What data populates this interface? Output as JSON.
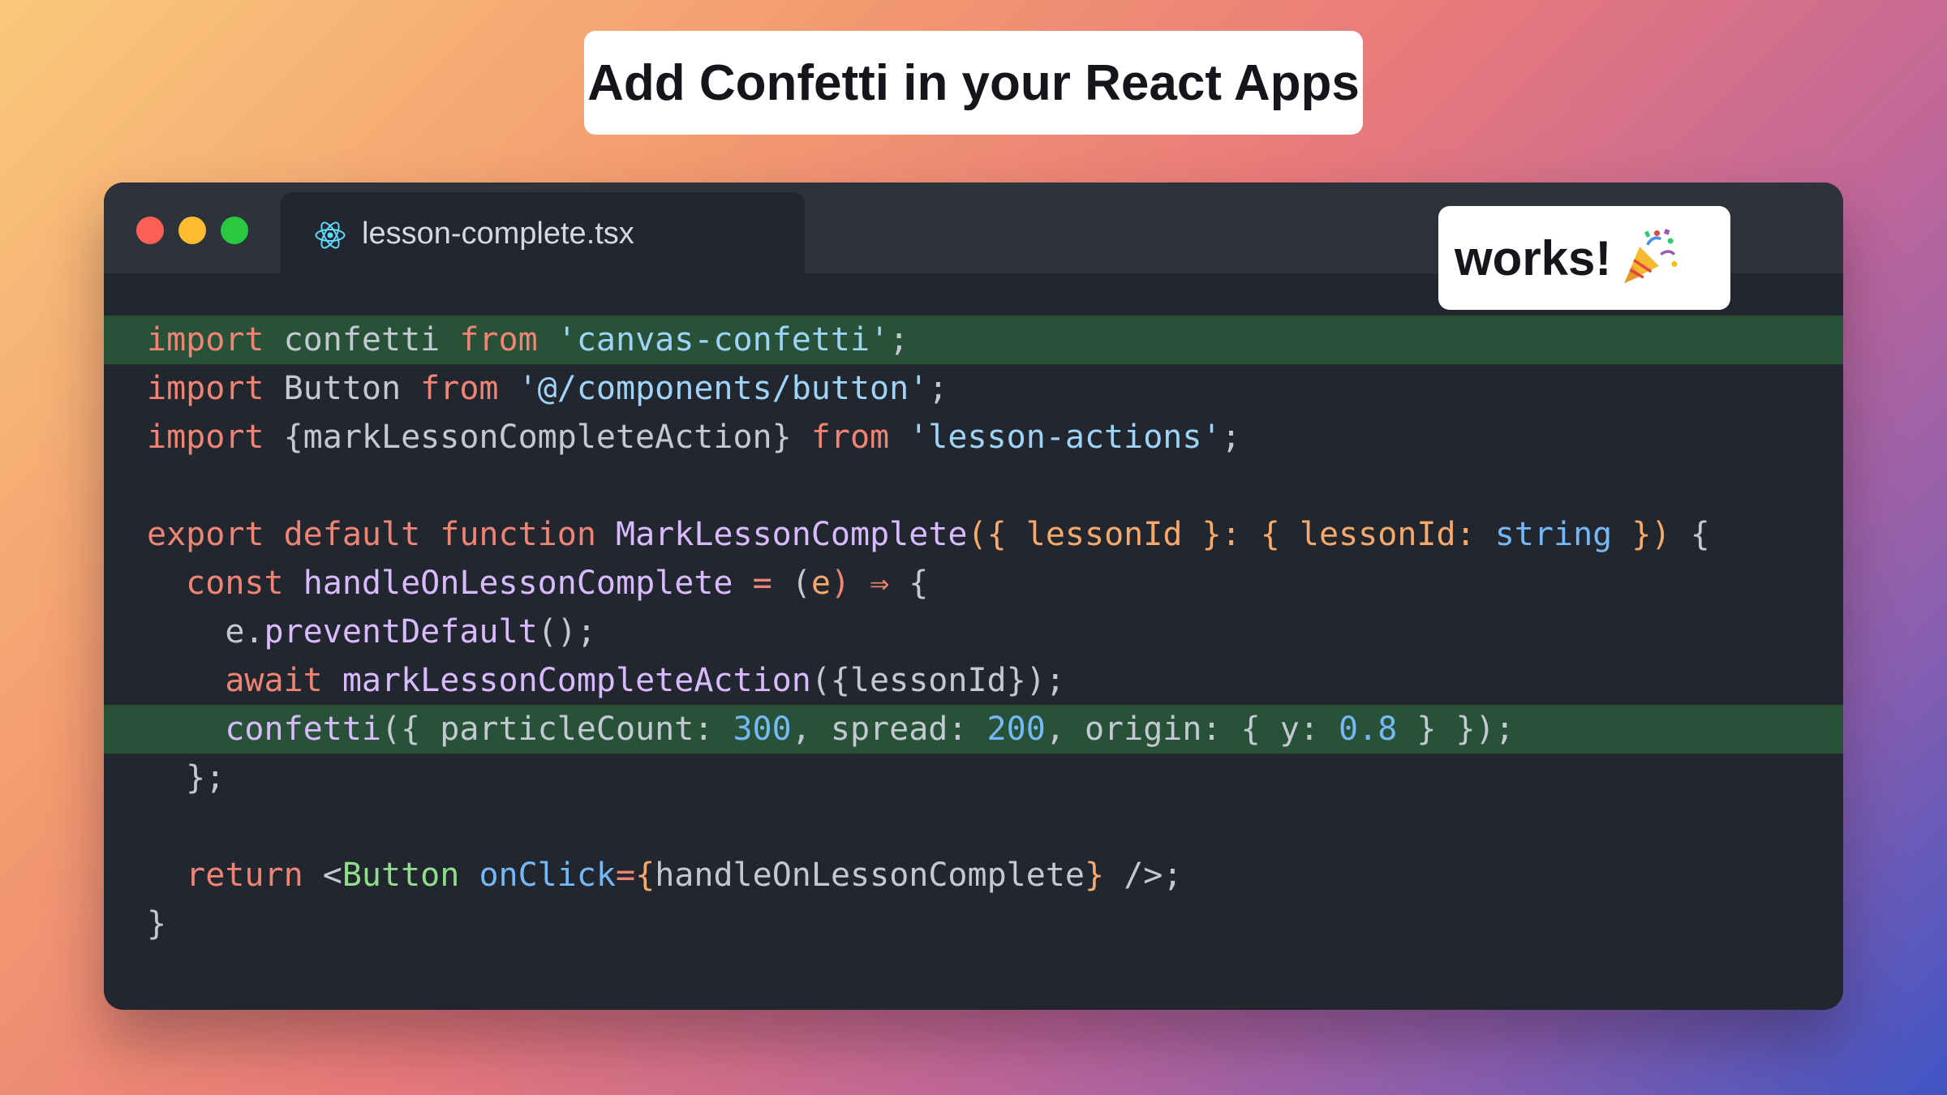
{
  "header": {
    "title": "Add Confetti in your React Apps"
  },
  "editor": {
    "tab": {
      "filename": "lesson-complete.tsx",
      "icon": "react-atom-icon"
    },
    "colors": {
      "background": "#22262e",
      "titlebar": "#2e323a",
      "highlight": "#275238",
      "keyword": "#f08474",
      "string": "#9fd3f8",
      "function": "#d9b9ff",
      "parameter": "#f6a96a",
      "number": "#75b8f5",
      "jsx_tag": "#8fde8a"
    },
    "window_controls": [
      "close-icon",
      "minimize-icon",
      "maximize-icon"
    ]
  },
  "badge": {
    "label": "works!",
    "icon": "party-popper-icon"
  },
  "code": {
    "l1": {
      "import": "import",
      "name": " confetti ",
      "from": "from",
      "space": " ",
      "module": "'canvas-confetti'",
      "semi": ";"
    },
    "l2": {
      "import": "import",
      "name": " Button ",
      "from": "from",
      "space": " ",
      "module": "'@/components/button'",
      "semi": ";"
    },
    "l3": {
      "import": "import",
      "name": " {markLessonCompleteAction} ",
      "from": "from",
      "space": " ",
      "module": "'lesson-actions'",
      "semi": ";"
    },
    "l5": {
      "export": "export",
      "s1": " ",
      "default": "default",
      "s2": " ",
      "function": "function",
      "s3": " ",
      "fname": "MarkLessonComplete",
      "open": "({ ",
      "param": "lessonId",
      "colon": " }: { ",
      "param2": "lessonId",
      "colon2": ": ",
      "type": "string",
      "close": " })",
      "brace": " {"
    },
    "l6": {
      "indent": "  ",
      "const": "const",
      "s1": " ",
      "name": "handleOnLessonComplete",
      "eq": " = ",
      "open": "(",
      "param": "e",
      "arrow": ") ⇒ ",
      "brace": "{"
    },
    "l7": {
      "indent": "    ",
      "obj": "e.",
      "fn": "preventDefault",
      "rest": "();"
    },
    "l8": {
      "indent": "    ",
      "await": "await",
      "s1": " ",
      "fn": "markLessonCompleteAction",
      "rest": "({lessonId});"
    },
    "l9": {
      "indent": "    ",
      "fn": "confetti",
      "open": "({ particleCount: ",
      "n1": "300",
      "mid1": ", spread: ",
      "n2": "200",
      "mid2": ", origin: { y: ",
      "n3": "0.8",
      "close": " } });"
    },
    "l10": {
      "text": "  };"
    },
    "l12": {
      "indent": "  ",
      "return": "return",
      "lt": " <",
      "tag": "Button",
      "s1": " ",
      "attr": "onClick",
      "eq": "=",
      "ob": "{",
      "handler": "handleOnLessonComplete",
      "cb": "}",
      "end": " />;"
    },
    "l13": {
      "text": "}"
    }
  }
}
